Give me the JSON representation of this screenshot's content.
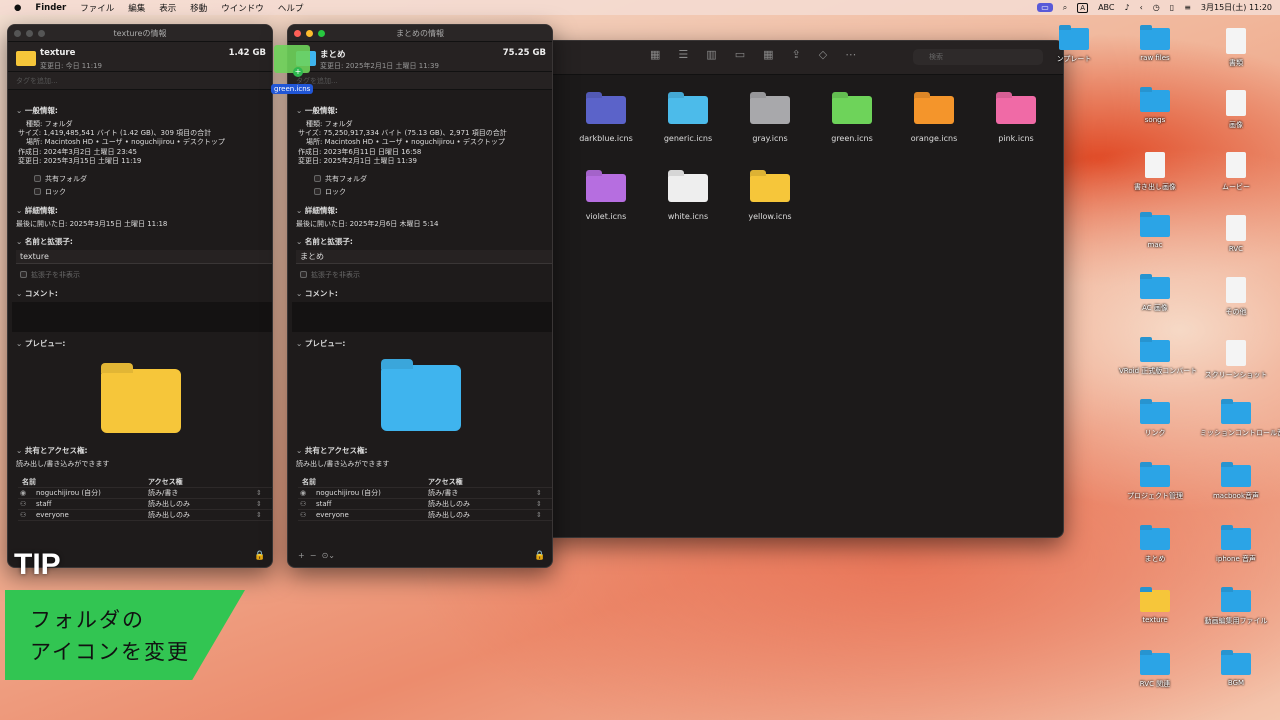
{
  "menubar": {
    "app": "Finder",
    "items": [
      "ファイル",
      "編集",
      "表示",
      "移動",
      "ウインドウ",
      "ヘルプ"
    ],
    "input": "ABC",
    "input_a": "A",
    "datetime": "3月15日(土) 11:20"
  },
  "win1": {
    "title": "textureの情報",
    "name": "texture",
    "size": "1.42 GB",
    "modified": "変更日: 今日 11:19",
    "tags_placeholder": "タグを追加...",
    "general": "一般情報:",
    "kind": "種類: フォルダ",
    "sizeline": "サイズ: 1,419,485,541 バイト (1.42 GB)、309 項目の合計",
    "where": "場所: Macintosh HD • ユーザ • noguchijirou • デスクトップ",
    "created": "作成日: 2024年3月2日 土曜日 23:45",
    "changed": "変更日: 2025年3月15日 土曜日 11:19",
    "shared": "共有フォルダ",
    "locked": "ロック",
    "more": "詳細情報:",
    "last_opened": "最後に開いた日: 2025年3月15日 土曜日 11:18",
    "name_ext": "名前と拡張子:",
    "name_value": "texture",
    "hide_ext": "拡張子を非表示",
    "comments": "コメント:",
    "preview": "プレビュー:",
    "sharing": "共有とアクセス権:",
    "rw": "読み出し/書き込みができます",
    "col_name": "名前",
    "col_access": "アクセス権",
    "rows": [
      {
        "n": "noguchijirou (自分)",
        "a": "読み/書き"
      },
      {
        "n": "staff",
        "a": "読み出しのみ"
      },
      {
        "n": "everyone",
        "a": "読み出しのみ"
      }
    ]
  },
  "win2": {
    "title": "まとめの情報",
    "name": "まとめ",
    "size": "75.25 GB",
    "modified": "変更日: 2025年2月1日 土曜日 11:39",
    "tags_placeholder": "タグを追加...",
    "general": "一般情報:",
    "kind": "種類: フォルダ",
    "sizeline": "サイズ: 75,250,917,334 バイト (75.13 GB)、2,971 項目の合計",
    "where": "場所: Macintosh HD • ユーザ • noguchijirou • デスクトップ",
    "created": "作成日: 2023年6月11日 日曜日 16:58",
    "changed": "変更日: 2025年2月1日 土曜日 11:39",
    "shared": "共有フォルダ",
    "locked": "ロック",
    "more": "詳細情報:",
    "last_opened": "最後に開いた日: 2025年2月6日 木曜日 5:14",
    "name_ext": "名前と拡張子:",
    "name_value": "まとめ",
    "hide_ext": "拡張子を非表示",
    "comments": "コメント:",
    "preview": "プレビュー:",
    "sharing": "共有とアクセス権:",
    "rw": "読み出し/書き込みができます",
    "col_name": "名前",
    "col_access": "アクセス権",
    "rows": [
      {
        "n": "noguchijirou (自分)",
        "a": "読み/書き"
      },
      {
        "n": "staff",
        "a": "読み出しのみ"
      },
      {
        "n": "everyone",
        "a": "読み出しのみ"
      }
    ]
  },
  "drag": {
    "label": "green.icns"
  },
  "finder": {
    "search_placeholder": "検索",
    "icons": [
      {
        "l": "darkblue.icns",
        "c": "#5b63c9"
      },
      {
        "l": "generic.icns",
        "c": "#4cbbea"
      },
      {
        "l": "gray.icns",
        "c": "#a8a8ab"
      },
      {
        "l": "green.icns",
        "c": "#6ed35a"
      },
      {
        "l": "orange.icns",
        "c": "#f4952b"
      },
      {
        "l": "pink.icns",
        "c": "#f06aa6"
      },
      {
        "l": "violet.icns",
        "c": "#b66ee0"
      },
      {
        "l": "white.icns",
        "c": "#eeeeee"
      },
      {
        "l": "yellow.icns",
        "c": "#f6c63a"
      }
    ]
  },
  "desktop": [
    {
      "l": "ンプレート",
      "t": "folder"
    },
    {
      "l": "raw files",
      "t": "folder"
    },
    {
      "l": "書類",
      "t": "doc"
    },
    {
      "l": "songs",
      "t": "folder"
    },
    {
      "l": "画像",
      "t": "doc"
    },
    {
      "l": "書き出し画像",
      "t": "doc"
    },
    {
      "l": "ムービー",
      "t": "doc"
    },
    {
      "l": "mac",
      "t": "folder"
    },
    {
      "l": "RVC",
      "t": "doc"
    },
    {
      "l": "AC 画像",
      "t": "folder"
    },
    {
      "l": "その他",
      "t": "doc"
    },
    {
      "l": "VRoid 正式版コンバート",
      "t": "folder"
    },
    {
      "l": "スクリーンショット",
      "t": "doc"
    },
    {
      "l": "リンク",
      "t": "folder"
    },
    {
      "l": "ミッションコントロール音声",
      "t": "folder"
    },
    {
      "l": "プロジェクト管理",
      "t": "folder"
    },
    {
      "l": "macbook音声",
      "t": "folder"
    },
    {
      "l": "まとめ",
      "t": "folder"
    },
    {
      "l": "iphone 音声",
      "t": "folder"
    },
    {
      "l": "texture",
      "t": "yellow"
    },
    {
      "l": "動画編集用ファイル",
      "t": "folder"
    },
    {
      "l": "RVC 関連",
      "t": "folder"
    },
    {
      "l": "BGM",
      "t": "folder"
    }
  ],
  "overlay": {
    "tip": "TIP",
    "line1": "フォルダの",
    "line2": "アイコンを変更"
  },
  "colors": {
    "yellow_folder": "#f6c63a",
    "blue_folder": "#3fb4ee",
    "green_banner": "#32c552"
  }
}
